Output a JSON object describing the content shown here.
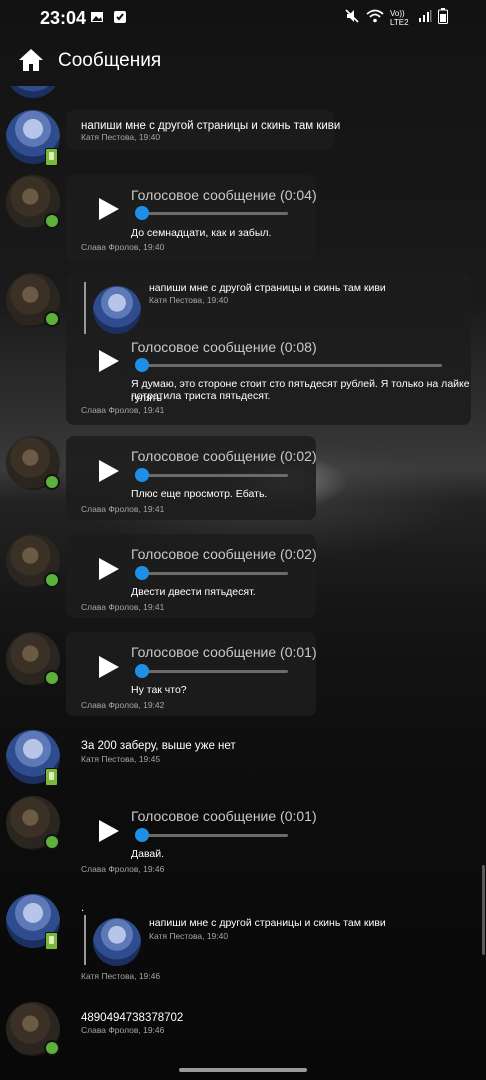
{
  "status_bar": {
    "time": "23:04",
    "network": "Vo)) LTE2",
    "icons": [
      "image-icon",
      "check-box-icon",
      "mute-icon",
      "wifi-icon",
      "signal-icon",
      "battery-icon"
    ]
  },
  "app_bar": {
    "title": "Сообщения",
    "icon": "home-icon"
  },
  "messages": [
    {
      "sender": "Катя Пестова",
      "time": "19:40",
      "meta": "Катя Пестова, 19:40",
      "text": "напиши мне с другой страницы и скинь там киви"
    },
    {
      "sender": "Слава Фролов",
      "time": "19:40",
      "meta": "Слава Фролов, 19:40",
      "voice_title": "Голосовое сообщение (0:04)",
      "transcript": "До семнадцати, как и забыл."
    },
    {
      "sender": "Слава Фролов",
      "time": "19:41",
      "meta": "Слава Фролов, 19:41",
      "quote": {
        "text": "напиши мне с другой страницы и скинь там киви",
        "meta": "Катя Пестова, 19:40"
      },
      "voice_title": "Голосовое сообщение (0:08)",
      "transcript_line1": "Я думаю, это стороне стоит сто пятьдесят рублей. Я только на лайке гулять",
      "transcript_line2": "потратила триста пятьдесят."
    },
    {
      "sender": "Слава Фролов",
      "time": "19:41",
      "meta": "Слава Фролов, 19:41",
      "voice_title": "Голосовое сообщение (0:02)",
      "transcript": "Плюс еще просмотр. Ебать."
    },
    {
      "sender": "Слава Фролов",
      "time": "19:41",
      "meta": "Слава Фролов, 19:41",
      "voice_title": "Голосовое сообщение (0:02)",
      "transcript": "Двести двести пятьдесят."
    },
    {
      "sender": "Слава Фролов",
      "time": "19:42",
      "meta": "Слава Фролов, 19:42",
      "voice_title": "Голосовое сообщение (0:01)",
      "transcript": "Ну так что?"
    },
    {
      "sender": "Катя Пестова",
      "time": "19:45",
      "meta": "Катя Пестова, 19:45",
      "text": "За 200 заберу, выше уже нет"
    },
    {
      "sender": "Слава Фролов",
      "time": "19:46",
      "meta": "Слава Фролов, 19:46",
      "voice_title": "Голосовое сообщение (0:01)",
      "transcript": "Давай."
    },
    {
      "sender": "Катя Пестова",
      "time": "19:46",
      "meta": "Катя Пестова, 19:46",
      "text": ".",
      "quote": {
        "text": "напиши мне с другой страницы и скинь там киви",
        "meta": "Катя Пестова, 19:40"
      }
    },
    {
      "sender": "Слава Фролов",
      "time": "19:46",
      "meta": "Слава Фролов, 19:46",
      "text": "4890494738378702"
    }
  ],
  "colors": {
    "accent_knob": "#1e8fe6",
    "online_dot": "#5bb13a",
    "mobile_badge": "#7ab83b",
    "bubble": "#1c1c1c"
  }
}
